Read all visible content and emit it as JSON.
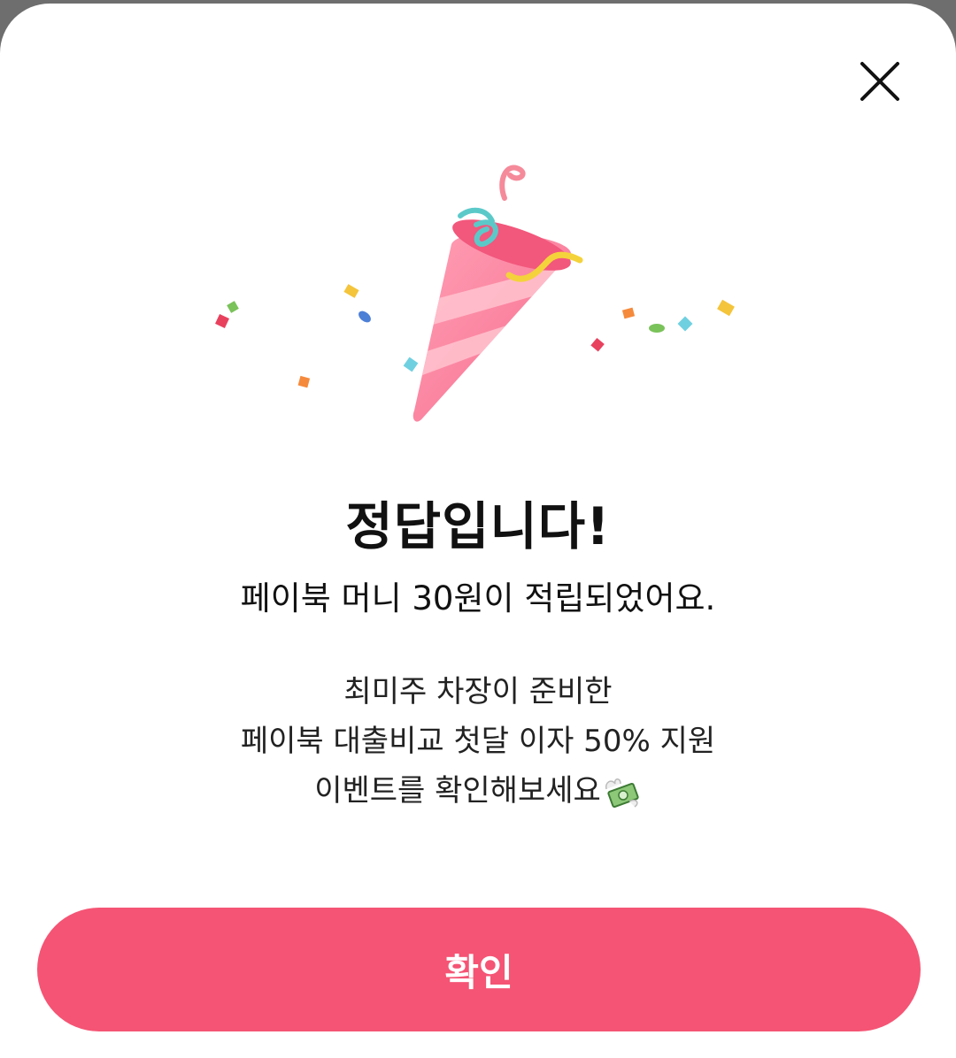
{
  "dialog": {
    "title": "정답입니다!",
    "subtitle": "페이북 머니 30원이 적립되었어요.",
    "description_lines": [
      "최미주 차장이 준비한",
      "페이북 대출비교 첫달 이자 50% 지원",
      "이벤트를 확인해보세요"
    ],
    "description_icon": "money-with-wings-icon",
    "illustration_icon": "party-popper-icon",
    "confirm_label": "확인",
    "close_icon": "close-icon"
  },
  "colors": {
    "accent": "#f55474",
    "text": "#111111",
    "background": "#ffffff"
  }
}
